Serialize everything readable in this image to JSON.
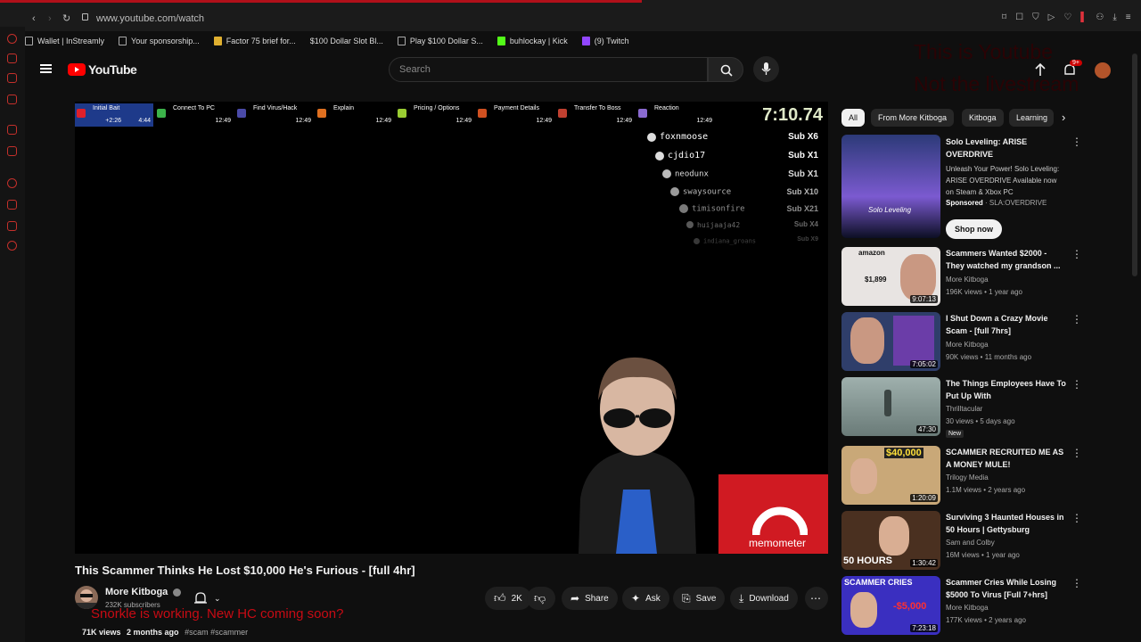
{
  "browser": {
    "url": "www.youtube.com/watch",
    "bookmarks": [
      "Wallet | InStreamly",
      "Your sponsorship...",
      "Factor 75 brief for...",
      "$100 Dollar Slot Bl...",
      "Play $100 Dollar S...",
      "buhlockay | Kick",
      "(9) Twitch"
    ]
  },
  "header": {
    "logo": "YouTube",
    "search_placeholder": "Search",
    "notification_count": "9+"
  },
  "overlay_corner_text": [
    "This is Youtube",
    "Not the livestream"
  ],
  "player": {
    "segments": [
      {
        "label": "Initial Bait",
        "time": "2:26",
        "time2": "4:44",
        "color": "#e0202a"
      },
      {
        "label": "Connect To PC",
        "time": "12:49",
        "color": "#3cb34a"
      },
      {
        "label": "Find Virus/Hack",
        "time": "12:49",
        "color": "#4a4aa8"
      },
      {
        "label": "Explain",
        "time": "12:49",
        "color": "#e07020"
      },
      {
        "label": "Pricing / Options",
        "time": "12:49",
        "color": "#9acd32"
      },
      {
        "label": "Payment Details",
        "time": "12:49",
        "color": "#d05020"
      },
      {
        "label": "Transfer To Boss",
        "time": "12:49",
        "color": "#c04030"
      },
      {
        "label": "Reaction",
        "time": "12:49",
        "color": "#8a6ad0"
      }
    ],
    "timer": "7:10.74",
    "subs": [
      {
        "name": "foxnmoose",
        "sub": "Sub X6"
      },
      {
        "name": "cjdio17",
        "sub": "Sub X1"
      },
      {
        "name": "neodunx",
        "sub": "Sub X1"
      },
      {
        "name": "swaysource",
        "sub": "Sub X10"
      },
      {
        "name": "timisonfire",
        "sub": "Sub X21"
      },
      {
        "name": "huijaaja42",
        "sub": "Sub X4"
      },
      {
        "name": "indiana_groans",
        "sub": "Sub X9"
      }
    ],
    "memometer": "memometer"
  },
  "video": {
    "title": "This Scammer Thinks He Lost $10,000 He's Furious - [full 4hr]",
    "channel": "More Kitboga",
    "subscribers": "232K subscribers",
    "likes": "2K",
    "share": "Share",
    "ask": "Ask",
    "save": "Save",
    "download": "Download",
    "views": "71K views",
    "age": "2 months ago",
    "tags": "#scam #scammer",
    "overlay_message": "Snorkle is working. New HC coming soon?"
  },
  "chips": [
    "All",
    "From More Kitboga",
    "Kitboga",
    "Learning"
  ],
  "sidebar": [
    {
      "title": "Solo Leveling: ARISE OVERDRIVE",
      "desc": "Unleash Your Power! Solo Leveling: ARISE OVERDRIVE Available now on Steam & Xbox PC",
      "sponsored": "Sponsored",
      "advertiser": "SLA:OVERDRIVE",
      "cta": "Shop now"
    },
    {
      "title": "Scammers Wanted $2000 - They watched my grandson ...",
      "channel": "More Kitboga",
      "meta": "196K views • 1 year ago",
      "duration": "9:07:13",
      "price": "$1,899"
    },
    {
      "title": "I Shut Down a Crazy Movie Scam - [full 7hrs]",
      "channel": "More Kitboga",
      "meta": "90K views • 11 months ago",
      "duration": "7:05:02"
    },
    {
      "title": "The Things Employees Have To Put Up With",
      "channel": "Thrilltacular",
      "meta": "30 views • 5 days ago",
      "duration": "47:30",
      "badge": "New"
    },
    {
      "title": "SCAMMER RECRUITED ME AS A MONEY MULE!",
      "channel": "Trilogy Media",
      "meta": "1.1M views • 2 years ago",
      "duration": "1:20:09",
      "price": "$40,000"
    },
    {
      "title": "Surviving 3 Haunted Houses in 50 Hours | Gettysburg",
      "channel": "Sam and Colby",
      "meta": "16M views • 1 year ago",
      "duration": "1:30:42",
      "thumb_text": "50 HOURS"
    },
    {
      "title": "Scammer Cries While Losing $5000 To Virus [Full 7+hrs]",
      "channel": "More Kitboga",
      "meta": "177K views • 2 years ago",
      "duration": "7:23:18",
      "thumb_text": "SCAMMER CRIES",
      "price": "-$5,000"
    }
  ]
}
